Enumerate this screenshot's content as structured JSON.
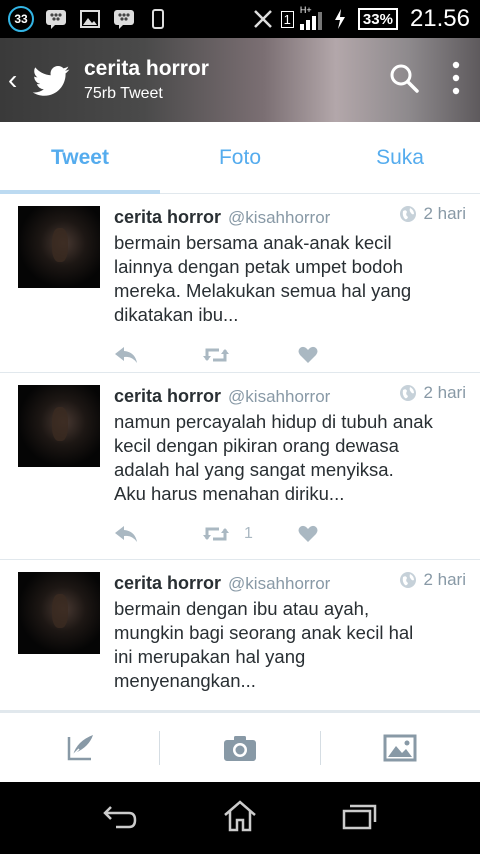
{
  "status_bar": {
    "badge": "33",
    "sim_number": "1",
    "network": "H+",
    "battery": "33%",
    "time": "21.56"
  },
  "header": {
    "title": "cerita horror",
    "subtitle": "75rb Tweet"
  },
  "tabs": [
    {
      "label": "Tweet",
      "active": true
    },
    {
      "label": "Foto",
      "active": false
    },
    {
      "label": "Suka",
      "active": false
    }
  ],
  "tweets": [
    {
      "name": "cerita horror",
      "handle": "@kisahhorror",
      "time": "2 hari",
      "lines": [
        "bermain bersama anak-anak kecil",
        "lainnya dengan petak umpet bodoh",
        "mereka. Melakukan semua hal yang",
        "dikatakan ibu..."
      ],
      "retweets": ""
    },
    {
      "name": "cerita horror",
      "handle": "@kisahhorror",
      "time": "2 hari",
      "lines": [
        "namun percayalah hidup di tubuh anak",
        "kecil dengan pikiran orang dewasa",
        "adalah hal yang sangat menyiksa.",
        "Aku harus menahan diriku..."
      ],
      "retweets": "1"
    },
    {
      "name": "cerita horror",
      "handle": "@kisahhorror",
      "time": "2 hari",
      "lines": [
        "bermain dengan ibu atau ayah,",
        "mungkin bagi seorang anak kecil hal",
        "ini merupakan hal yang",
        "menyenangkan..."
      ],
      "retweets": ""
    }
  ],
  "colors": {
    "accent": "#55acee",
    "text": "#292f33",
    "muted": "#8899a6",
    "action": "#aab8c2"
  }
}
